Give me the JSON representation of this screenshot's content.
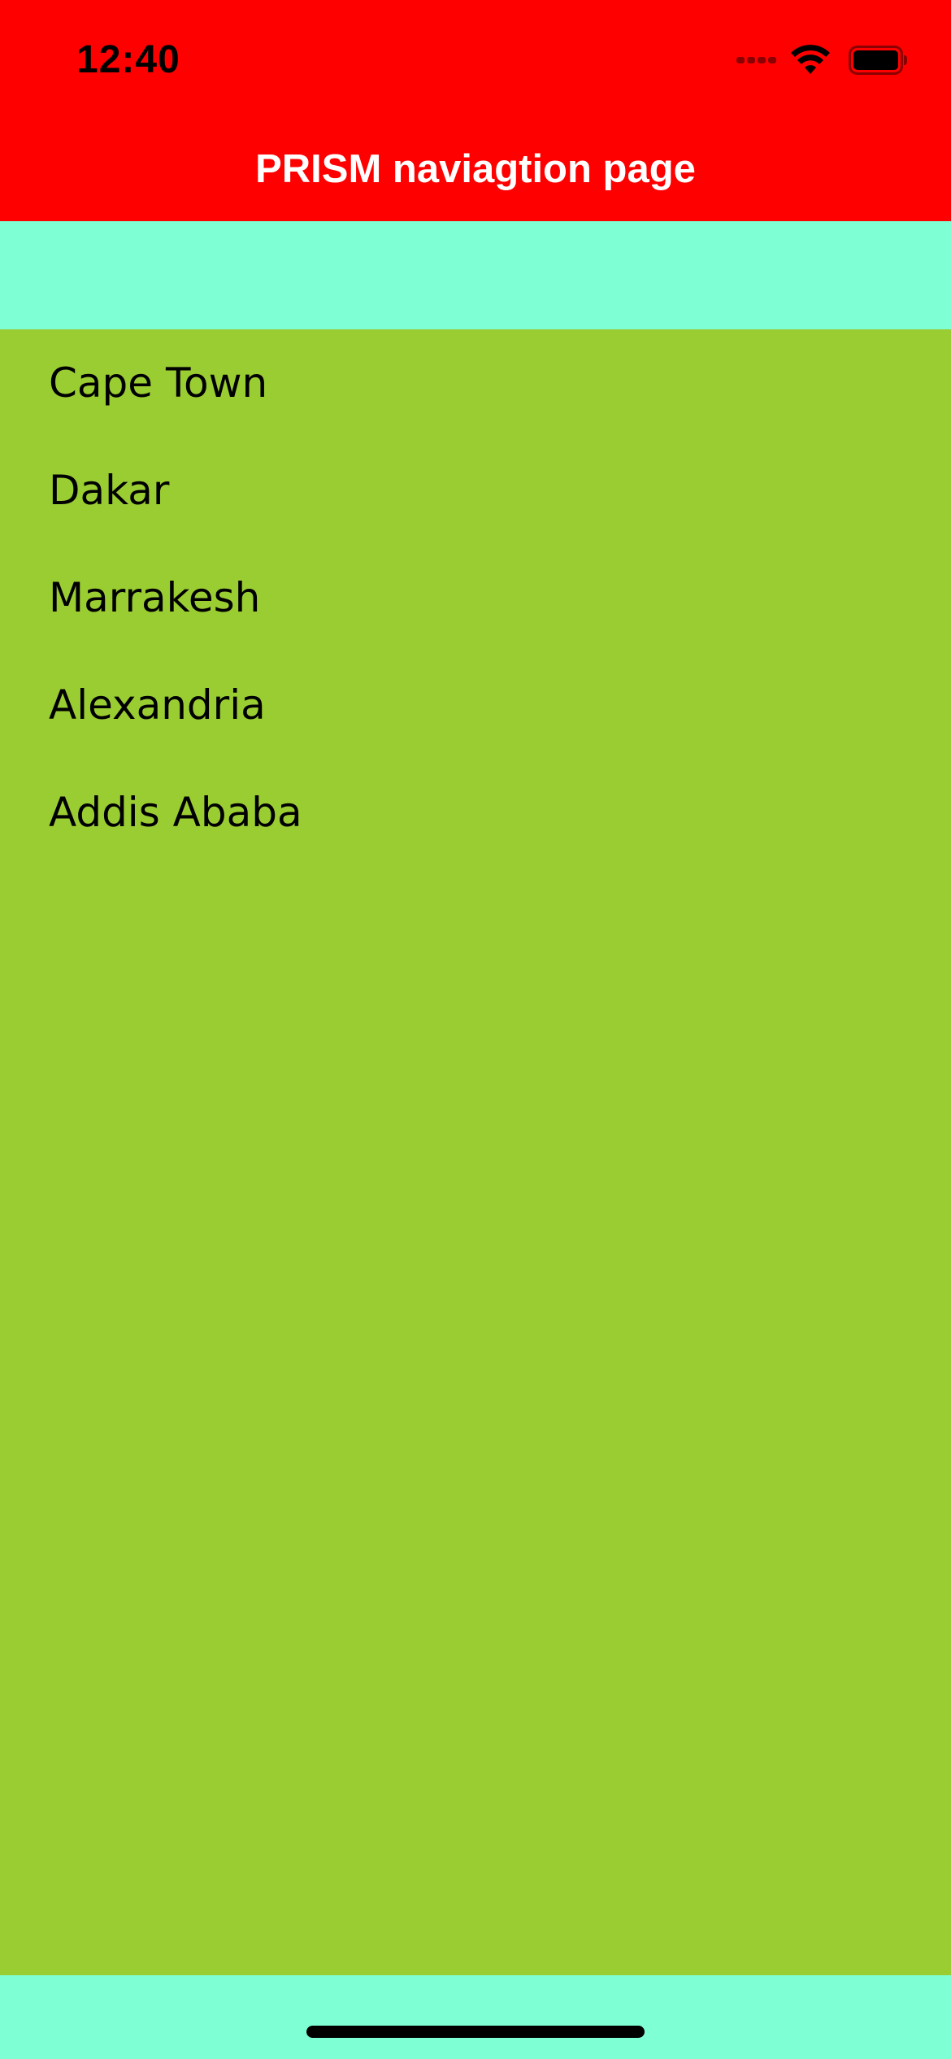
{
  "status_bar": {
    "time": "12:40",
    "icons": [
      "cellular-signal-icon",
      "wifi-icon",
      "battery-icon"
    ]
  },
  "nav": {
    "title": "PRISM naviagtion page"
  },
  "list": {
    "items": [
      {
        "label": "Cape Town"
      },
      {
        "label": "Dakar"
      },
      {
        "label": "Marrakesh"
      },
      {
        "label": "Alexandria"
      },
      {
        "label": "Addis Ababa"
      }
    ]
  },
  "colors": {
    "header_background": "#ff0000",
    "band_background": "#7fffd4",
    "list_background": "#9acd32",
    "title_text": "#ffffff",
    "item_text": "#000000"
  }
}
